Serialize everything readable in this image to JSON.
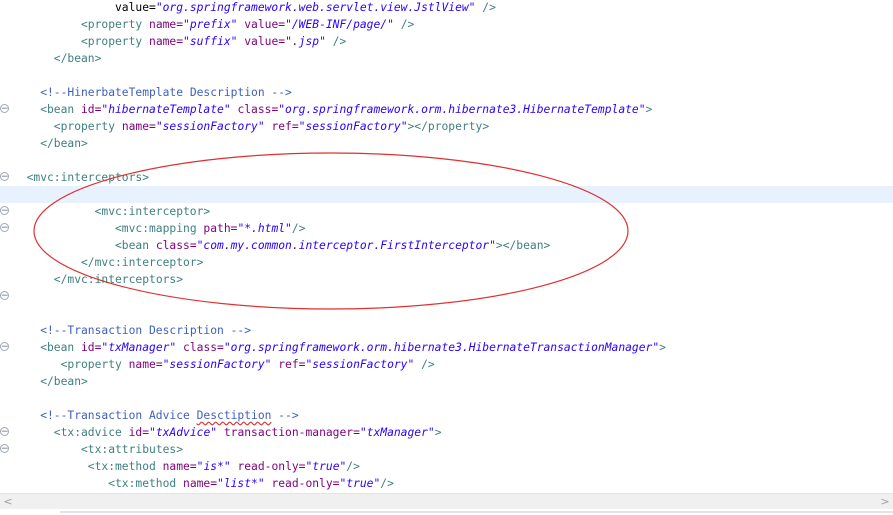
{
  "editor": {
    "lines": [
      {
        "indent": 15,
        "fold": false,
        "tokens": [
          [
            "txt",
            "value="
          ],
          [
            "val",
            "\"org.springframework.web.servlet.view.JstlView\""
          ],
          [
            "tag",
            " />"
          ]
        ]
      },
      {
        "indent": 10,
        "fold": false,
        "tokens": [
          [
            "tag",
            "<property "
          ],
          [
            "attr",
            "name="
          ],
          [
            "val",
            "\"prefix\""
          ],
          [
            "attr",
            " value="
          ],
          [
            "val",
            "\"/WEB-INF/page/\""
          ],
          [
            "tag",
            " />"
          ]
        ]
      },
      {
        "indent": 10,
        "fold": false,
        "tokens": [
          [
            "tag",
            "<property "
          ],
          [
            "attr",
            "name="
          ],
          [
            "val",
            "\"suffix\""
          ],
          [
            "attr",
            " value="
          ],
          [
            "val",
            "\".jsp\""
          ],
          [
            "tag",
            " />"
          ]
        ]
      },
      {
        "indent": 6,
        "fold": false,
        "tokens": [
          [
            "tag",
            "</bean>"
          ]
        ]
      },
      {
        "indent": 0,
        "fold": false,
        "tokens": []
      },
      {
        "indent": 4,
        "fold": false,
        "tokens": [
          [
            "cmt",
            "<!--HinerbateTemplate Description -->"
          ]
        ]
      },
      {
        "indent": 4,
        "fold": true,
        "tokens": [
          [
            "tag",
            "<bean "
          ],
          [
            "attr",
            "id="
          ],
          [
            "val",
            "\"hibernateTemplate\""
          ],
          [
            "attr",
            " class="
          ],
          [
            "val",
            "\"org.springframework.orm.hibernate3.HibernateTemplate\""
          ],
          [
            "tag",
            ">"
          ]
        ]
      },
      {
        "indent": 6,
        "fold": false,
        "tokens": [
          [
            "tag",
            "<property "
          ],
          [
            "attr",
            "name="
          ],
          [
            "val",
            "\"sessionFactory\""
          ],
          [
            "attr",
            " ref="
          ],
          [
            "val",
            "\"sessionFactory\""
          ],
          [
            "tag",
            "></property>"
          ]
        ]
      },
      {
        "indent": 4,
        "fold": false,
        "tokens": [
          [
            "tag",
            "</bean>"
          ]
        ]
      },
      {
        "indent": 0,
        "fold": false,
        "tokens": []
      },
      {
        "indent": 2,
        "fold": true,
        "tokens": [
          [
            "tag",
            "<mvc:interceptors>"
          ]
        ]
      },
      {
        "indent": 0,
        "fold": false,
        "current": true,
        "tokens": []
      },
      {
        "indent": 12,
        "fold": true,
        "tokens": [
          [
            "tag",
            "<mvc:interceptor>"
          ]
        ]
      },
      {
        "indent": 15,
        "fold": true,
        "tokens": [
          [
            "tag",
            "<mvc:mapping "
          ],
          [
            "attr",
            "path="
          ],
          [
            "val",
            "\"*.html\""
          ],
          [
            "tag",
            "/>"
          ]
        ]
      },
      {
        "indent": 15,
        "fold": false,
        "tokens": [
          [
            "tag",
            "<bean "
          ],
          [
            "attr",
            "class="
          ],
          [
            "val",
            "\"com.my.common.interceptor.FirstInterceptor\""
          ],
          [
            "tag",
            "></bean>"
          ]
        ]
      },
      {
        "indent": 10,
        "fold": false,
        "tokens": [
          [
            "tag",
            "</mvc:interceptor>"
          ]
        ]
      },
      {
        "indent": 6,
        "fold": false,
        "tokens": [
          [
            "tag",
            "</mvc:interceptors>"
          ]
        ]
      },
      {
        "indent": 0,
        "fold": true,
        "tokens": []
      },
      {
        "indent": 0,
        "fold": false,
        "tokens": []
      },
      {
        "indent": 4,
        "fold": false,
        "tokens": [
          [
            "cmt",
            "<!--Transaction Description -->"
          ]
        ]
      },
      {
        "indent": 4,
        "fold": true,
        "tokens": [
          [
            "tag",
            "<bean "
          ],
          [
            "attr",
            "id="
          ],
          [
            "val",
            "\"txManager\""
          ],
          [
            "attr",
            " class="
          ],
          [
            "val",
            "\"org.springframework.orm.hibernate3.HibernateTransactionManager\""
          ],
          [
            "tag",
            ">"
          ]
        ]
      },
      {
        "indent": 7,
        "fold": false,
        "tokens": [
          [
            "tag",
            "<property "
          ],
          [
            "attr",
            "name="
          ],
          [
            "val",
            "\"sessionFactory\""
          ],
          [
            "attr",
            " ref="
          ],
          [
            "val",
            "\"sessionFactory\""
          ],
          [
            "tag",
            " />"
          ]
        ]
      },
      {
        "indent": 4,
        "fold": false,
        "tokens": [
          [
            "tag",
            "</bean>"
          ]
        ]
      },
      {
        "indent": 0,
        "fold": false,
        "tokens": []
      },
      {
        "indent": 4,
        "fold": false,
        "tokens": [
          [
            "cmt",
            "<!--Transaction Advice "
          ],
          [
            "cmt sq",
            "Desctiption"
          ],
          [
            "cmt",
            " -->"
          ]
        ]
      },
      {
        "indent": 6,
        "fold": true,
        "tokens": [
          [
            "tag",
            "<tx:advice "
          ],
          [
            "attr",
            "id="
          ],
          [
            "val",
            "\"txAdvice\""
          ],
          [
            "attr",
            " transaction-manager="
          ],
          [
            "val",
            "\"txManager\""
          ],
          [
            "tag",
            ">"
          ]
        ]
      },
      {
        "indent": 10,
        "fold": true,
        "tokens": [
          [
            "tag",
            "<tx:attributes>"
          ]
        ]
      },
      {
        "indent": 11,
        "fold": false,
        "tokens": [
          [
            "tag",
            "<tx:method "
          ],
          [
            "attr",
            "name="
          ],
          [
            "val",
            "\"is*\""
          ],
          [
            "attr",
            " read-only="
          ],
          [
            "val",
            "\"true\""
          ],
          [
            "tag",
            "/>"
          ]
        ]
      },
      {
        "indent": 14,
        "fold": false,
        "tokens": [
          [
            "tag",
            "<tx:method "
          ],
          [
            "attr",
            "name="
          ],
          [
            "val",
            "\"list*\""
          ],
          [
            "attr",
            " read-only="
          ],
          [
            "val",
            "\"true\""
          ],
          [
            "tag",
            "/>"
          ]
        ]
      }
    ]
  },
  "scrollbar": {
    "left_arrow": "<",
    "right_arrow": ">"
  },
  "annotation": {
    "color": "#e03030"
  }
}
